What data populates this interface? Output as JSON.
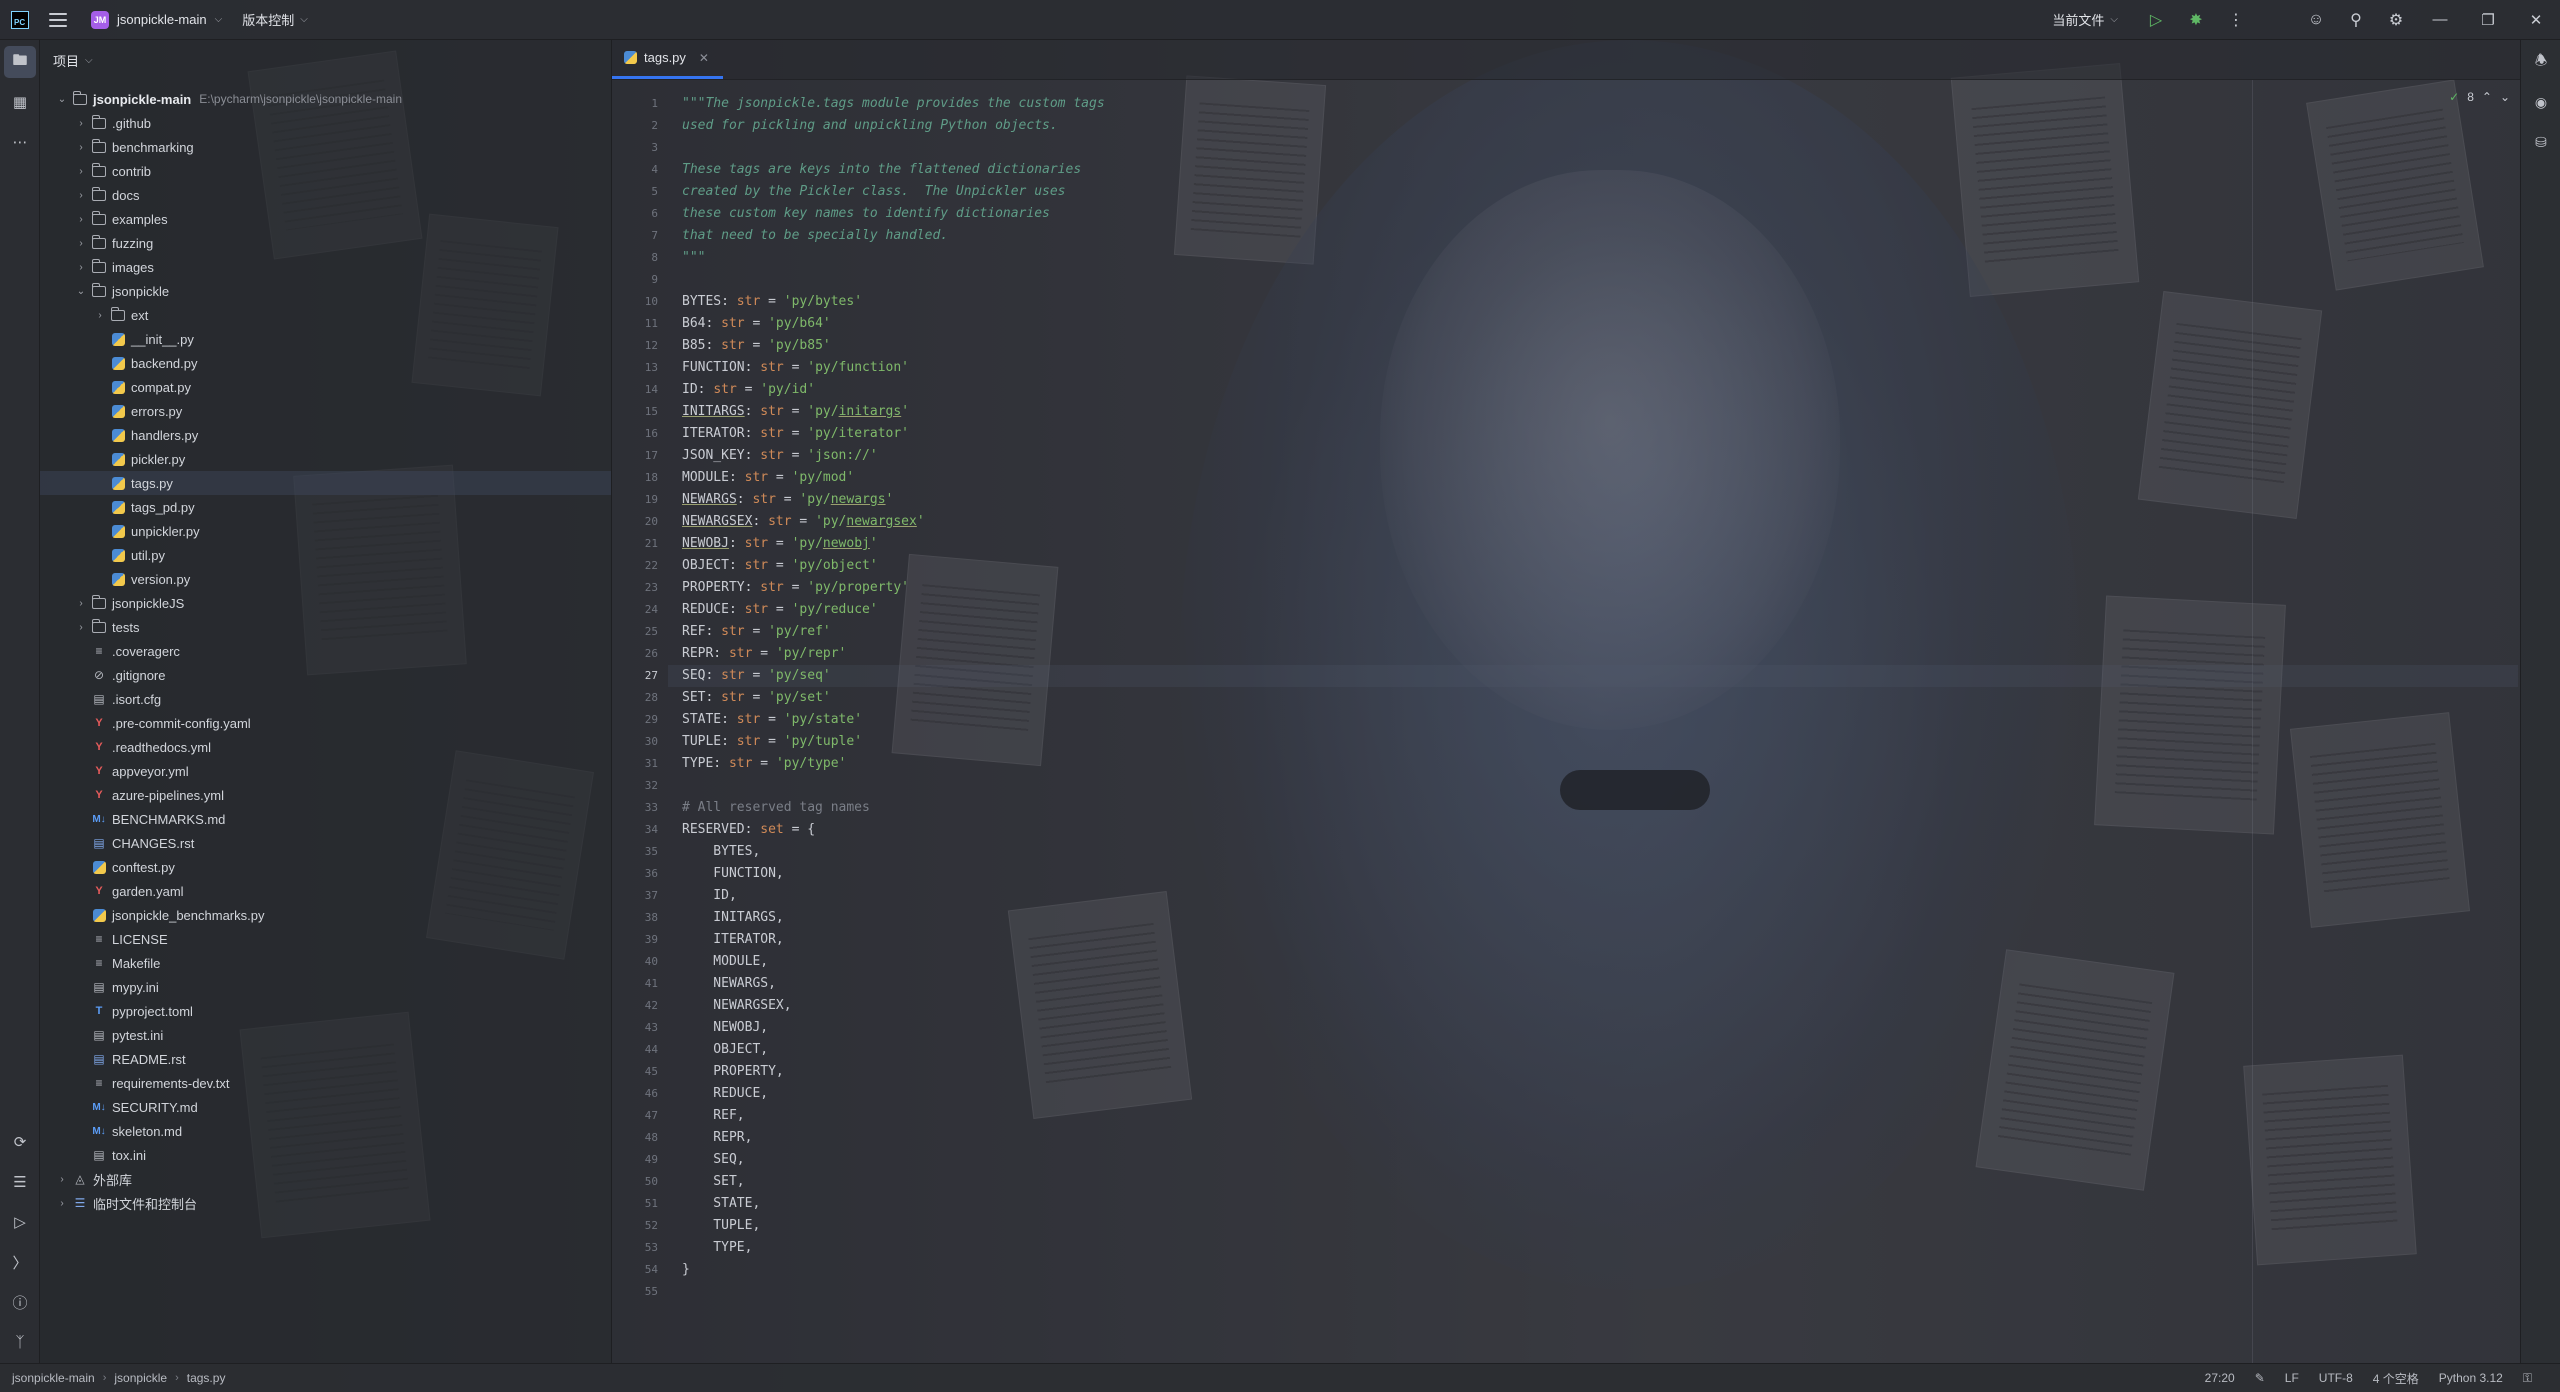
{
  "titlebar": {
    "project_badge": "JM",
    "project_name": "jsonpickle-main",
    "vcs_label": "版本控制",
    "run_config": "当前文件"
  },
  "project_panel": {
    "title": "项目",
    "root": {
      "name": "jsonpickle-main",
      "path": "E:\\pycharm\\jsonpickle\\jsonpickle-main"
    },
    "items": [
      {
        "label": ".github",
        "type": "folder",
        "depth": 1,
        "expanded": false
      },
      {
        "label": "benchmarking",
        "type": "folder",
        "depth": 1,
        "expanded": false
      },
      {
        "label": "contrib",
        "type": "folder",
        "depth": 1,
        "expanded": false
      },
      {
        "label": "docs",
        "type": "folder",
        "depth": 1,
        "expanded": false
      },
      {
        "label": "examples",
        "type": "folder",
        "depth": 1,
        "expanded": false
      },
      {
        "label": "fuzzing",
        "type": "folder",
        "depth": 1,
        "expanded": false
      },
      {
        "label": "images",
        "type": "folder",
        "depth": 1,
        "expanded": false
      },
      {
        "label": "jsonpickle",
        "type": "folder",
        "depth": 1,
        "expanded": true
      },
      {
        "label": "ext",
        "type": "folder",
        "depth": 2,
        "expanded": false
      },
      {
        "label": "__init__.py",
        "type": "py",
        "depth": 2
      },
      {
        "label": "backend.py",
        "type": "py",
        "depth": 2
      },
      {
        "label": "compat.py",
        "type": "py",
        "depth": 2
      },
      {
        "label": "errors.py",
        "type": "py",
        "depth": 2
      },
      {
        "label": "handlers.py",
        "type": "py",
        "depth": 2
      },
      {
        "label": "pickler.py",
        "type": "py",
        "depth": 2
      },
      {
        "label": "tags.py",
        "type": "py",
        "depth": 2
      },
      {
        "label": "tags_pd.py",
        "type": "py",
        "depth": 2
      },
      {
        "label": "unpickler.py",
        "type": "py",
        "depth": 2
      },
      {
        "label": "util.py",
        "type": "py",
        "depth": 2
      },
      {
        "label": "version.py",
        "type": "py",
        "depth": 2
      },
      {
        "label": "jsonpickleJS",
        "type": "folder",
        "depth": 1,
        "expanded": false
      },
      {
        "label": "tests",
        "type": "folder",
        "depth": 1,
        "expanded": false
      },
      {
        "label": ".coveragerc",
        "type": "txt",
        "depth": 1
      },
      {
        "label": ".gitignore",
        "type": "ignore",
        "depth": 1
      },
      {
        "label": ".isort.cfg",
        "type": "cfg",
        "depth": 1
      },
      {
        "label": ".pre-commit-config.yaml",
        "type": "yaml",
        "depth": 1
      },
      {
        "label": ".readthedocs.yml",
        "type": "yaml",
        "depth": 1
      },
      {
        "label": "appveyor.yml",
        "type": "yaml",
        "depth": 1
      },
      {
        "label": "azure-pipelines.yml",
        "type": "yaml",
        "depth": 1
      },
      {
        "label": "BENCHMARKS.md",
        "type": "md",
        "depth": 1
      },
      {
        "label": "CHANGES.rst",
        "type": "rst",
        "depth": 1
      },
      {
        "label": "conftest.py",
        "type": "py",
        "depth": 1
      },
      {
        "label": "garden.yaml",
        "type": "yaml",
        "depth": 1
      },
      {
        "label": "jsonpickle_benchmarks.py",
        "type": "py",
        "depth": 1
      },
      {
        "label": "LICENSE",
        "type": "txt",
        "depth": 1
      },
      {
        "label": "Makefile",
        "type": "txt",
        "depth": 1
      },
      {
        "label": "mypy.ini",
        "type": "cfg",
        "depth": 1
      },
      {
        "label": "pyproject.toml",
        "type": "toml",
        "depth": 1
      },
      {
        "label": "pytest.ini",
        "type": "cfg",
        "depth": 1
      },
      {
        "label": "README.rst",
        "type": "rst",
        "depth": 1
      },
      {
        "label": "requirements-dev.txt",
        "type": "txt",
        "depth": 1
      },
      {
        "label": "SECURITY.md",
        "type": "md",
        "depth": 1
      },
      {
        "label": "skeleton.md",
        "type": "md",
        "depth": 1
      },
      {
        "label": "tox.ini",
        "type": "cfg",
        "depth": 1
      },
      {
        "label": "外部库",
        "type": "lib",
        "depth": 0,
        "expanded": false
      },
      {
        "label": "临时文件和控制台",
        "type": "scratch",
        "depth": 0,
        "expanded": false
      }
    ]
  },
  "editor": {
    "tab_label": "tags.py",
    "inspection_count": "8",
    "current_line": 27,
    "lines": [
      [
        [
          "doc",
          "\"\"\"The jsonpickle.tags module provides the custom tags"
        ]
      ],
      [
        [
          "doc",
          "used for pickling and unpickling Python objects."
        ]
      ],
      [],
      [
        [
          "doc",
          "These tags are keys into the flattened dictionaries"
        ]
      ],
      [
        [
          "doc",
          "created by the Pickler class.  The Unpickler uses"
        ]
      ],
      [
        [
          "doc",
          "these custom key names to identify dictionaries"
        ]
      ],
      [
        [
          "doc",
          "that need to be specially handled."
        ]
      ],
      [
        [
          "doc",
          "\"\"\""
        ]
      ],
      [],
      [
        [
          "p",
          "BYTES: "
        ],
        [
          "kw",
          "str"
        ],
        [
          "p",
          " = "
        ],
        [
          "str",
          "'py/bytes'"
        ]
      ],
      [
        [
          "p",
          "B64: "
        ],
        [
          "kw",
          "str"
        ],
        [
          "p",
          " = "
        ],
        [
          "str",
          "'py/b64'"
        ]
      ],
      [
        [
          "p",
          "B85: "
        ],
        [
          "kw",
          "str"
        ],
        [
          "p",
          " = "
        ],
        [
          "str",
          "'py/b85'"
        ]
      ],
      [
        [
          "p",
          "FUNCTION: "
        ],
        [
          "kw",
          "str"
        ],
        [
          "p",
          " = "
        ],
        [
          "str",
          "'py/function'"
        ]
      ],
      [
        [
          "p",
          "ID: "
        ],
        [
          "kw",
          "str"
        ],
        [
          "p",
          " = "
        ],
        [
          "str",
          "'py/id'"
        ]
      ],
      [
        [
          "ul",
          "INITARGS"
        ],
        [
          "p",
          ": "
        ],
        [
          "kw",
          "str"
        ],
        [
          "p",
          " = "
        ],
        [
          "str",
          "'py/"
        ],
        [
          "strul",
          "initargs"
        ],
        [
          "str",
          "'"
        ]
      ],
      [
        [
          "p",
          "ITERATOR: "
        ],
        [
          "kw",
          "str"
        ],
        [
          "p",
          " = "
        ],
        [
          "str",
          "'py/iterator'"
        ]
      ],
      [
        [
          "p",
          "JSON_KEY: "
        ],
        [
          "kw",
          "str"
        ],
        [
          "p",
          " = "
        ],
        [
          "str",
          "'json://'"
        ]
      ],
      [
        [
          "p",
          "MODULE: "
        ],
        [
          "kw",
          "str"
        ],
        [
          "p",
          " = "
        ],
        [
          "str",
          "'py/mod'"
        ]
      ],
      [
        [
          "ul",
          "NEWARGS"
        ],
        [
          "p",
          ": "
        ],
        [
          "kw",
          "str"
        ],
        [
          "p",
          " = "
        ],
        [
          "str",
          "'py/"
        ],
        [
          "strul",
          "newargs"
        ],
        [
          "str",
          "'"
        ]
      ],
      [
        [
          "ul",
          "NEWARGSEX"
        ],
        [
          "p",
          ": "
        ],
        [
          "kw",
          "str"
        ],
        [
          "p",
          " = "
        ],
        [
          "str",
          "'py/"
        ],
        [
          "strul",
          "newargsex"
        ],
        [
          "str",
          "'"
        ]
      ],
      [
        [
          "ul",
          "NEWOBJ"
        ],
        [
          "p",
          ": "
        ],
        [
          "kw",
          "str"
        ],
        [
          "p",
          " = "
        ],
        [
          "str",
          "'py/"
        ],
        [
          "strul",
          "newobj"
        ],
        [
          "str",
          "'"
        ]
      ],
      [
        [
          "p",
          "OBJECT: "
        ],
        [
          "kw",
          "str"
        ],
        [
          "p",
          " = "
        ],
        [
          "str",
          "'py/object'"
        ]
      ],
      [
        [
          "p",
          "PROPERTY: "
        ],
        [
          "kw",
          "str"
        ],
        [
          "p",
          " = "
        ],
        [
          "str",
          "'py/property'"
        ]
      ],
      [
        [
          "p",
          "REDUCE: "
        ],
        [
          "kw",
          "str"
        ],
        [
          "p",
          " = "
        ],
        [
          "str",
          "'py/reduce'"
        ]
      ],
      [
        [
          "p",
          "REF: "
        ],
        [
          "kw",
          "str"
        ],
        [
          "p",
          " = "
        ],
        [
          "str",
          "'py/ref'"
        ]
      ],
      [
        [
          "p",
          "REPR: "
        ],
        [
          "kw",
          "str"
        ],
        [
          "p",
          " = "
        ],
        [
          "str",
          "'py/repr'"
        ]
      ],
      [
        [
          "p",
          "SEQ: "
        ],
        [
          "kw",
          "str"
        ],
        [
          "p",
          " = "
        ],
        [
          "str",
          "'py/seq'"
        ]
      ],
      [
        [
          "p",
          "SET: "
        ],
        [
          "kw",
          "str"
        ],
        [
          "p",
          " = "
        ],
        [
          "str",
          "'py/set'"
        ]
      ],
      [
        [
          "p",
          "STATE: "
        ],
        [
          "kw",
          "str"
        ],
        [
          "p",
          " = "
        ],
        [
          "str",
          "'py/state'"
        ]
      ],
      [
        [
          "p",
          "TUPLE: "
        ],
        [
          "kw",
          "str"
        ],
        [
          "p",
          " = "
        ],
        [
          "str",
          "'py/tuple'"
        ]
      ],
      [
        [
          "p",
          "TYPE: "
        ],
        [
          "kw",
          "str"
        ],
        [
          "p",
          " = "
        ],
        [
          "str",
          "'py/type'"
        ]
      ],
      [],
      [
        [
          "cmt",
          "# All reserved tag names"
        ]
      ],
      [
        [
          "p",
          "RESERVED: "
        ],
        [
          "kw",
          "set"
        ],
        [
          "p",
          " = {"
        ]
      ],
      [
        [
          "p",
          "    BYTES,"
        ]
      ],
      [
        [
          "p",
          "    FUNCTION,"
        ]
      ],
      [
        [
          "p",
          "    ID,"
        ]
      ],
      [
        [
          "p",
          "    INITARGS,"
        ]
      ],
      [
        [
          "p",
          "    ITERATOR,"
        ]
      ],
      [
        [
          "p",
          "    MODULE,"
        ]
      ],
      [
        [
          "p",
          "    NEWARGS,"
        ]
      ],
      [
        [
          "p",
          "    NEWARGSEX,"
        ]
      ],
      [
        [
          "p",
          "    NEWOBJ,"
        ]
      ],
      [
        [
          "p",
          "    OBJECT,"
        ]
      ],
      [
        [
          "p",
          "    PROPERTY,"
        ]
      ],
      [
        [
          "p",
          "    REDUCE,"
        ]
      ],
      [
        [
          "p",
          "    REF,"
        ]
      ],
      [
        [
          "p",
          "    REPR,"
        ]
      ],
      [
        [
          "p",
          "    SEQ,"
        ]
      ],
      [
        [
          "p",
          "    SET,"
        ]
      ],
      [
        [
          "p",
          "    STATE,"
        ]
      ],
      [
        [
          "p",
          "    TUPLE,"
        ]
      ],
      [
        [
          "p",
          "    TYPE,"
        ]
      ],
      [
        [
          "p",
          "}"
        ]
      ],
      []
    ]
  },
  "statusbar": {
    "breadcrumbs": [
      "jsonpickle-main",
      "jsonpickle",
      "tags.py"
    ],
    "position": "27:20",
    "line_ending": "LF",
    "encoding": "UTF-8",
    "indent": "4 个空格",
    "interpreter": "Python 3.12"
  },
  "colors": {
    "accent": "#3574f0",
    "string": "#7fb96a",
    "keyword": "#d08a58",
    "docstring": "#5f9c87",
    "project_badge": "#a55ee8"
  }
}
